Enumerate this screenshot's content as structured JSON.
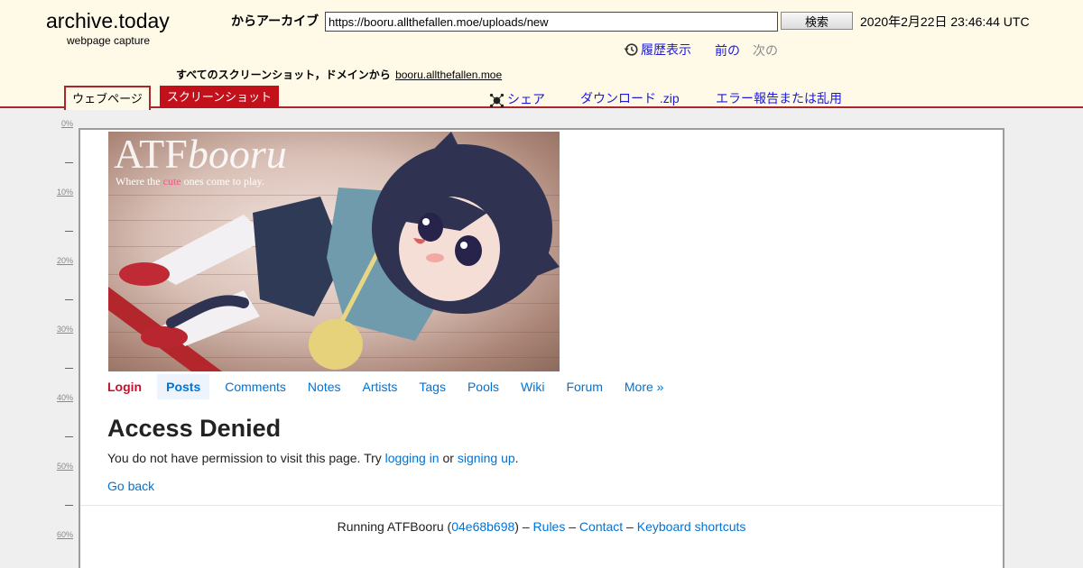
{
  "archive_header": {
    "brand_title": "archive.today",
    "brand_subtitle": "webpage capture",
    "archive_label": "からアーカイブ",
    "url_value": "https://booru.allthefallen.moe/uploads/new",
    "search_button": "検索",
    "capture_date": "2020年2月22日 23:46:44 UTC",
    "history_label": "履歴表示",
    "prev_label": "前の",
    "next_label": "次の",
    "domain_prefix": "すべてのスクリーンショット，ドメインから",
    "domain_link": "booru.allthefallen.moe",
    "tabs": [
      "ウェブページ",
      "スクリーンショット"
    ],
    "share_label": "シェア",
    "download_label": "ダウンロード .zip",
    "report_label": "エラー報告または乱用",
    "colors": {
      "header_bg": "#fffae8",
      "accent": "#a9272a",
      "link": "#1a1adb"
    }
  },
  "ruler": {
    "marks": [
      "0%",
      "10%",
      "20%",
      "30%",
      "40%",
      "50%",
      "60%"
    ]
  },
  "captured_page": {
    "banner": {
      "title_plain": "ATF",
      "title_italic": "booru",
      "tagline_before": "Where the ",
      "tagline_highlight": "cute",
      "tagline_after": " ones come to play."
    },
    "nav": {
      "items": [
        "Login",
        "Posts",
        "Comments",
        "Notes",
        "Artists",
        "Tags",
        "Pools",
        "Wiki",
        "Forum",
        "More »"
      ]
    },
    "access": {
      "title": "Access Denied",
      "message_before": "You do not have permission to visit this page. Try ",
      "login_link": "logging in",
      "message_middle": " or ",
      "signup_link": "signing up",
      "message_after": ".",
      "go_back": "Go back"
    },
    "footer": {
      "running": "Running ATFBooru (",
      "commit": "04e68b698",
      "close_paren": ")",
      "dash1": " – ",
      "rules": "Rules",
      "dash2": " – ",
      "contact": "Contact",
      "dash3": " – ",
      "shortcuts": "Keyboard shortcuts"
    },
    "colors": {
      "link": "#0073d6",
      "login": "#c8102e",
      "highlight": "#ff4f8f"
    }
  }
}
